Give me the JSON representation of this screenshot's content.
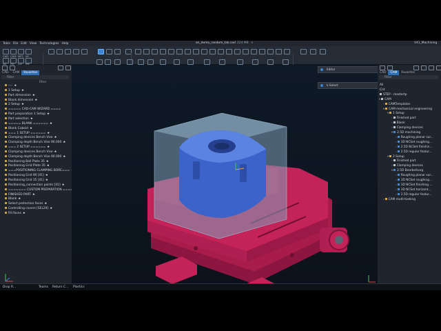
{
  "window": {
    "menu": [
      "Tebis",
      "File",
      "Edit",
      "View",
      "Technologies",
      "Help"
    ],
    "document_title": "an_demo_random_tak.cad",
    "document_size": "224 MB",
    "close_glyph": "×",
    "app_name": "V41_Machining"
  },
  "ribbon": {
    "left_labels": [
      "CAD",
      "CAM",
      "MPC",
      "NC"
    ],
    "left_labels2": [
      "Sol",
      "Fac",
      "Cur",
      "Pnt"
    ]
  },
  "left_panel": {
    "tabs": [
      "CAD",
      "CAM",
      "Favorites"
    ],
    "filter_label": "Filter",
    "filter_label_right": "Filter",
    "items": [
      {
        "label": "----",
        "star": true
      },
      {
        "label": "1 Setup",
        "star": true
      },
      {
        "label": "Part dimension",
        "star": true
      },
      {
        "label": "Blank dimension",
        "star": true
      },
      {
        "label": "2 Setup",
        "star": true
      },
      {
        "label": "===== CAD-CAM WIZARD ====",
        "star": false
      },
      {
        "label": "Part preparation 1 Setup",
        "star": true
      },
      {
        "label": "Part selection",
        "star": true
      },
      {
        "label": "===== BLANK ======",
        "star": true
      },
      {
        "label": "Blank Cuboid",
        "star": true
      },
      {
        "label": "=== 1 SETUP ======",
        "star": true
      },
      {
        "label": "Clamping devices Bench Vise",
        "star": true
      },
      {
        "label": "Clamping depth Bench Vise 90.000",
        "star": true
      },
      {
        "label": "=== 2 SETUP ======",
        "star": true
      },
      {
        "label": "Clamping devices Bench Vise",
        "star": true
      },
      {
        "label": "Clamping depth Bench Vise 90.000",
        "star": true
      },
      {
        "label": "Positioning Ball Plate 35",
        "star": true
      },
      {
        "label": "Positioning Grid Plate 35",
        "star": true
      },
      {
        "label": "===POSITIONING CLAMPING BORE===",
        "star": true
      },
      {
        "label": "Positioning Grid 90 [41]",
        "star": true
      },
      {
        "label": "Positioning Grid 35 [41]",
        "star": true
      },
      {
        "label": "Positioning_connection points [41]",
        "star": true
      },
      {
        "label": "======= CUSTOM PREPARATION ====",
        "star": true
      },
      {
        "label": "FINISHED PART",
        "star": true
      },
      {
        "label": "Blank",
        "star": true
      },
      {
        "label": "Select protection faces",
        "star": true
      },
      {
        "label": "Controlling covers [SEL29]",
        "star": true
      },
      {
        "label": "Fill faces",
        "star": true
      }
    ]
  },
  "right_panel": {
    "tabs": [
      "CAD",
      "CAM",
      "Favorites"
    ],
    "tree": [
      {
        "label": "All",
        "indent": 0,
        "icon": "none",
        "twisty": ""
      },
      {
        "label": "Cnt",
        "indent": 0,
        "icon": "none",
        "twisty": ""
      },
      {
        "label": "STEP - mastertp",
        "indent": 0,
        "icon": "w",
        "twisty": ""
      },
      {
        "label": "CAM",
        "indent": 0,
        "icon": "w",
        "twisty": "▾"
      },
      {
        "label": "CAMTemplates",
        "indent": 1,
        "icon": "g",
        "twisty": "›"
      },
      {
        "label": "CAM mechanical engineering",
        "indent": 1,
        "icon": "g",
        "twisty": "▾"
      },
      {
        "label": "1 Setup",
        "indent": 2,
        "icon": "g",
        "twisty": "▾"
      },
      {
        "label": "Finished part",
        "indent": 3,
        "icon": "w",
        "twisty": "›"
      },
      {
        "label": "Blank",
        "indent": 3,
        "icon": "w",
        "twisty": "›"
      },
      {
        "label": "Clamping devices",
        "indent": 3,
        "icon": "w",
        "twisty": "›"
      },
      {
        "label": "2.5D machining",
        "indent": 3,
        "icon": "b",
        "twisty": "▾"
      },
      {
        "label": "Roughing planar sur...",
        "indent": 4,
        "icon": "b",
        "twisty": "›"
      },
      {
        "label": "3D NCSet roughing...",
        "indent": 4,
        "icon": "b",
        "twisty": "›"
      },
      {
        "label": "2.5D NCSet finishin...",
        "indent": 4,
        "icon": "b",
        "twisty": "›"
      },
      {
        "label": "2.5D regular featur...",
        "indent": 4,
        "icon": "b",
        "twisty": "›"
      },
      {
        "label": "2 Setup",
        "indent": 2,
        "icon": "g",
        "twisty": "▾"
      },
      {
        "label": "Finished part",
        "indent": 3,
        "icon": "w",
        "twisty": "›"
      },
      {
        "label": "Clamping devices",
        "indent": 3,
        "icon": "w",
        "twisty": "›"
      },
      {
        "label": "2.5D Bearbeitung",
        "indent": 3,
        "icon": "b",
        "twisty": "▾"
      },
      {
        "label": "Roughing planar sur...",
        "indent": 4,
        "icon": "b",
        "twisty": "›"
      },
      {
        "label": "3D NCSet roughing...",
        "indent": 4,
        "icon": "b",
        "twisty": "›"
      },
      {
        "label": "3D NCSet finishing ...",
        "indent": 4,
        "icon": "b",
        "twisty": "›"
      },
      {
        "label": "3D NCSet horizont...",
        "indent": 4,
        "icon": "b",
        "twisty": "›"
      },
      {
        "label": "2.5D regular featur...",
        "indent": 4,
        "icon": "b",
        "twisty": "›"
      },
      {
        "label": "CAM multi-tasking",
        "indent": 1,
        "icon": "g",
        "twisty": "›"
      }
    ]
  },
  "viewport": {
    "tool_editor": "Editor",
    "tool_select": "k-Select"
  },
  "bottombar": {
    "left_value": "26",
    "drop_label": "Drop R...",
    "items": [
      "Teams",
      "Return C...",
      "Plastics"
    ]
  },
  "colors": {
    "vise": "#c4235a",
    "part": "#3b63c9",
    "blank": "#7fa0b8",
    "accent": "#3a86d0"
  }
}
